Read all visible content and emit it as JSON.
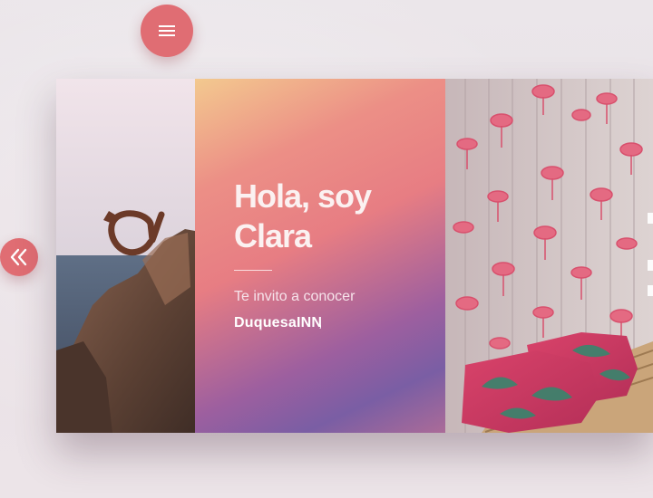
{
  "nav": {
    "menu_icon": "hamburger-menu-icon",
    "prev_icon": "double-chevron-left-icon"
  },
  "colors": {
    "accent": "#e06d73",
    "background": "#ebe6ea",
    "gradient_top": "#f3c98f",
    "gradient_mid": "#e77d83",
    "gradient_bottom": "#7a5ea4"
  },
  "slide": {
    "left_photo": "rocky-coast-sculpture-photo",
    "right_photo": "flamingo-wallpaper-bench-photo",
    "title": "Hola, soy Clara",
    "subtitle": "Te invito a conocer",
    "link": "DuquesaINN",
    "link_suffix": ","
  }
}
